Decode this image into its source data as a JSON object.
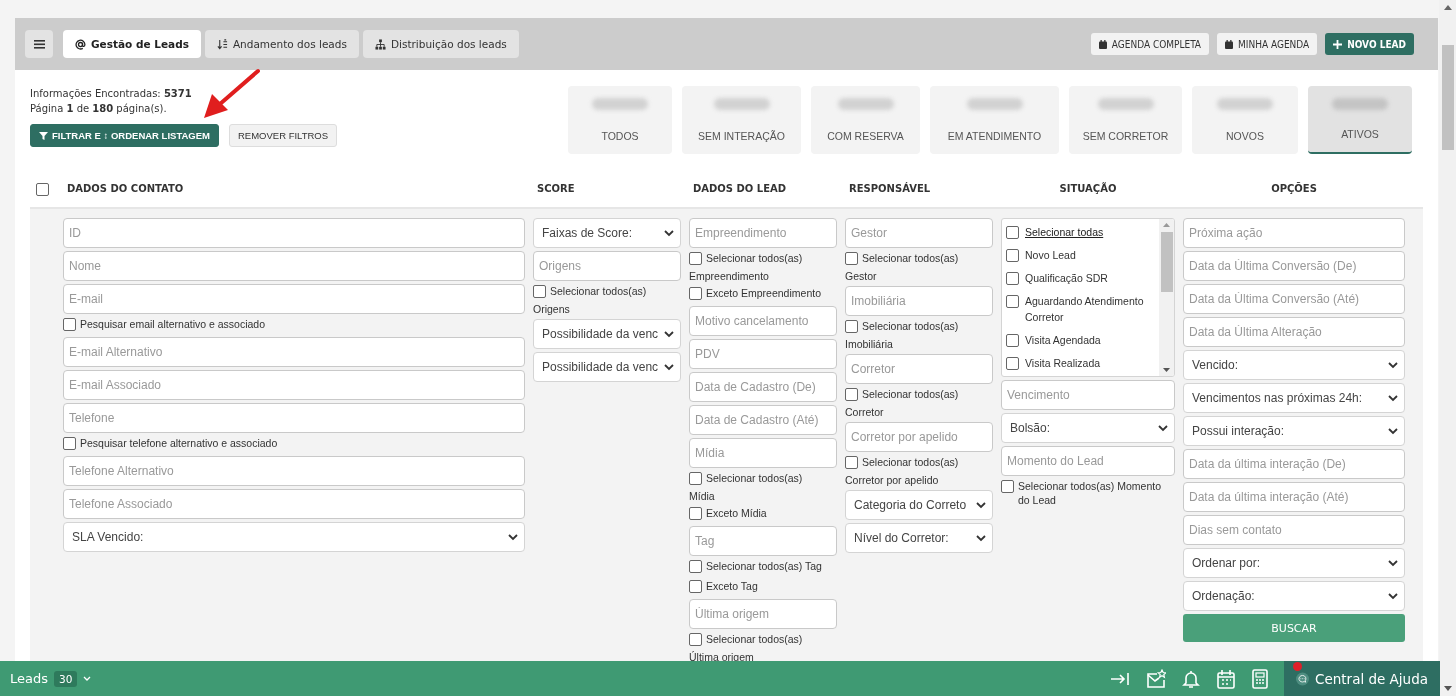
{
  "tabs": [
    {
      "label": "Gestão de Leads",
      "kind": "at",
      "selected": true
    },
    {
      "label": "Andamento dos leads",
      "kind": "sort",
      "selected": false
    },
    {
      "label": "Distribuição dos leads",
      "kind": "sitemap",
      "selected": false
    }
  ],
  "actions": [
    {
      "label": "AGENDA COMPLETA",
      "kind": "calendar",
      "primary": false
    },
    {
      "label": "MINHA AGENDA",
      "kind": "calendar",
      "primary": false
    },
    {
      "label": "NOVO LEAD",
      "kind": "plus",
      "primary": true
    }
  ],
  "summary": {
    "found": "Informações Encontradas: **5371**",
    "pages": "Página **1** de **180** página(s)."
  },
  "list_buttons": [
    {
      "label": "FILTRAR E ↕ ORDENAR LISTAGEM",
      "kind": "funnel",
      "primary": true
    },
    {
      "label": "REMOVER FILTROS",
      "kind": "plain",
      "primary": false
    }
  ],
  "stat_cards": [
    {
      "label": "TODOS",
      "selected": false
    },
    {
      "label": "SEM INTERAÇÃO",
      "selected": false
    },
    {
      "label": "COM RESERVA",
      "selected": false
    },
    {
      "label": "EM ATENDIMENTO",
      "selected": false
    },
    {
      "label": "SEM CORRETOR",
      "selected": false
    },
    {
      "label": "NOVOS",
      "selected": false
    },
    {
      "label": "ATIVOS",
      "selected": true
    }
  ],
  "table": {
    "select_all": {
      "checked": false
    },
    "columns": [
      {
        "label": "DADOS DO CONTATO"
      },
      {
        "label": "SCORE"
      },
      {
        "label": "DADOS DO LEAD"
      },
      {
        "label": "RESPONSÁVEL"
      },
      {
        "label": "SITUAÇÃO"
      },
      {
        "label": "OPÇÕES"
      }
    ]
  },
  "filters": [
    {
      "fields": [
        {
          "kind": "input",
          "placeholder": "ID"
        },
        {
          "kind": "input",
          "placeholder": "Nome"
        },
        {
          "kind": "input",
          "placeholder": "E-mail"
        },
        {
          "kind": "checkbox",
          "label": "Pesquisar email alternativo e associado",
          "checked": false
        },
        {
          "kind": "input",
          "placeholder": "E-mail Alternativo"
        },
        {
          "kind": "input",
          "placeholder": "E-mail Associado"
        },
        {
          "kind": "input",
          "placeholder": "Telefone"
        },
        {
          "kind": "checkbox",
          "label": "Pesquisar telefone alternativo e associado",
          "checked": false
        },
        {
          "kind": "input",
          "placeholder": "Telefone Alternativo"
        },
        {
          "kind": "input",
          "placeholder": "Telefone Associado"
        },
        {
          "kind": "select",
          "value": "SLA Vencido:"
        }
      ]
    },
    {
      "fields": [
        {
          "kind": "select",
          "value": "Faixas de Score:"
        },
        {
          "kind": "input",
          "placeholder": "Origens"
        },
        {
          "kind": "checkbox",
          "label": "Selecionar todos(as)",
          "checked": false
        },
        {
          "kind": "caption",
          "text": "Origens"
        },
        {
          "kind": "select",
          "value": "Possibilidade da venc"
        },
        {
          "kind": "select",
          "value": "Possibilidade da venc"
        }
      ]
    },
    {
      "fields": [
        {
          "kind": "input",
          "placeholder": "Empreendimento"
        },
        {
          "kind": "checkbox",
          "label": "Selecionar todos(as)",
          "checked": false
        },
        {
          "kind": "caption",
          "text": "Empreendimento"
        },
        {
          "kind": "checkbox",
          "label": "Exceto Empreendimento",
          "checked": false
        },
        {
          "kind": "input",
          "placeholder": "Motivo cancelamento"
        },
        {
          "kind": "input",
          "placeholder": "PDV"
        },
        {
          "kind": "input",
          "placeholder": "Data de Cadastro (De)"
        },
        {
          "kind": "input",
          "placeholder": "Data de Cadastro (Até)"
        },
        {
          "kind": "input",
          "placeholder": "Mídia"
        },
        {
          "kind": "checkbox",
          "label": "Selecionar todos(as)",
          "checked": false
        },
        {
          "kind": "caption",
          "text": "Mídia"
        },
        {
          "kind": "checkbox",
          "label": "Exceto Mídia",
          "checked": false
        },
        {
          "kind": "input",
          "placeholder": "Tag"
        },
        {
          "kind": "checkbox",
          "label": "Selecionar todos(as) Tag",
          "checked": false
        },
        {
          "kind": "checkbox",
          "label": "Exceto Tag",
          "checked": false
        },
        {
          "kind": "input",
          "placeholder": "Última origem"
        },
        {
          "kind": "checkbox",
          "label": "Selecionar todos(as)",
          "checked": false
        },
        {
          "kind": "caption",
          "text": "Última origem"
        }
      ]
    },
    {
      "fields": [
        {
          "kind": "input",
          "placeholder": "Gestor"
        },
        {
          "kind": "checkbox",
          "label": "Selecionar todos(as)",
          "checked": false
        },
        {
          "kind": "caption",
          "text": "Gestor"
        },
        {
          "kind": "input",
          "placeholder": "Imobiliária"
        },
        {
          "kind": "checkbox",
          "label": "Selecionar todos(as)",
          "checked": false
        },
        {
          "kind": "caption",
          "text": "Imobiliária"
        },
        {
          "kind": "input",
          "placeholder": "Corretor"
        },
        {
          "kind": "checkbox",
          "label": "Selecionar todos(as)",
          "checked": false
        },
        {
          "kind": "caption",
          "text": "Corretor"
        },
        {
          "kind": "input",
          "placeholder": "Corretor por apelido"
        },
        {
          "kind": "checkbox",
          "label": "Selecionar todos(as)",
          "checked": false
        },
        {
          "kind": "caption",
          "text": "Corretor por apelido"
        },
        {
          "kind": "select",
          "value": "Categoria do Correto"
        },
        {
          "kind": "select",
          "value": "Nível do Corretor:"
        }
      ]
    },
    {
      "fields": [
        {
          "kind": "checklist",
          "items": [
            {
              "label": "Selecionar todas",
              "kind": "all",
              "checked": false
            },
            {
              "label": "Novo Lead",
              "kind": "option",
              "checked": false
            },
            {
              "label": "Qualificação SDR",
              "kind": "option",
              "checked": false
            },
            {
              "label": "Aguardando Atendimento Corretor",
              "kind": "option",
              "checked": false
            },
            {
              "label": "Visita Agendada",
              "kind": "option",
              "checked": false
            },
            {
              "label": "Visita Realizada",
              "kind": "option",
              "checked": false
            }
          ]
        },
        {
          "kind": "input",
          "placeholder": "Vencimento"
        },
        {
          "kind": "select",
          "value": "Bolsão:"
        },
        {
          "kind": "input",
          "placeholder": "Momento do Lead"
        },
        {
          "kind": "checkbox",
          "label": "Selecionar todos(as) Momento do Lead",
          "checked": false
        }
      ]
    },
    {
      "fields": [
        {
          "kind": "input",
          "placeholder": "Próxima ação"
        },
        {
          "kind": "input",
          "placeholder": "Data da Última Conversão (De)"
        },
        {
          "kind": "input",
          "placeholder": "Data da Última Conversão (Até)"
        },
        {
          "kind": "input",
          "placeholder": "Data da Última Alteração"
        },
        {
          "kind": "select",
          "value": "Vencido:"
        },
        {
          "kind": "select",
          "value": "Vencimentos nas próximas 24h:"
        },
        {
          "kind": "select",
          "value": "Possui interação:"
        },
        {
          "kind": "input",
          "placeholder": "Data da última interação (De)"
        },
        {
          "kind": "input",
          "placeholder": "Data da última interação (Até)"
        },
        {
          "kind": "input",
          "placeholder": "Dias sem contato"
        },
        {
          "kind": "select",
          "value": "Ordenar por:"
        },
        {
          "kind": "select",
          "value": "Ordenação:"
        },
        {
          "kind": "button",
          "label": "BUSCAR"
        }
      ]
    }
  ],
  "bottom_bar": {
    "module": "Leads",
    "count": "30",
    "help": "Central de Ajuda",
    "unread": true
  },
  "annotations": [
    {
      "kind": "arrow"
    }
  ]
}
